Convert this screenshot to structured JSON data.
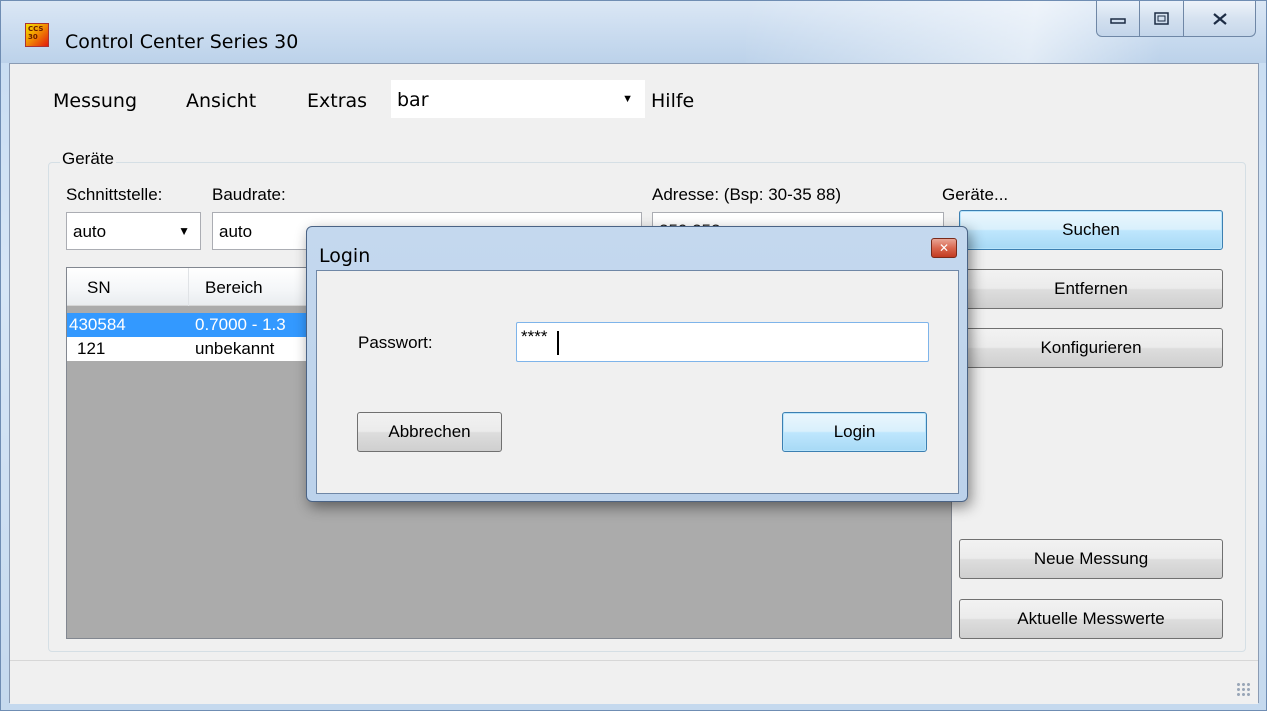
{
  "window": {
    "title": "Control Center Series 30",
    "app_icon_text": "CCS 30"
  },
  "menu": {
    "items": [
      "Messung",
      "Ansicht",
      "Extras",
      "Hilfe"
    ],
    "combo_value": "bar"
  },
  "devices": {
    "group_label": "Geräte",
    "interface_label": "Schnittstelle:",
    "interface_value": "auto",
    "baud_label": "Baudrate:",
    "baud_value": "auto",
    "address_label": "Adresse: (Bsp: 30-35 88)",
    "address_value": "250 252",
    "devices_label": "Geräte...",
    "list": {
      "columns": [
        "SN",
        "Bereich"
      ],
      "rows": [
        {
          "sn": "430584",
          "range": "0.7000 - 1.3",
          "selected": true
        },
        {
          "sn": "121",
          "range": "unbekannt",
          "selected": false
        }
      ]
    },
    "buttons": {
      "search": "Suchen",
      "remove": "Entfernen",
      "configure": "Konfigurieren",
      "new_measurement": "Neue Messung",
      "current_values": "Aktuelle Messwerte"
    }
  },
  "login_dialog": {
    "title": "Login",
    "password_label": "Passwort:",
    "password_value": "****",
    "cancel": "Abbrechen",
    "login": "Login"
  },
  "colors": {
    "selection": "#3399ff",
    "list_background": "#ababab",
    "window_frame": "#c6dbf1"
  }
}
